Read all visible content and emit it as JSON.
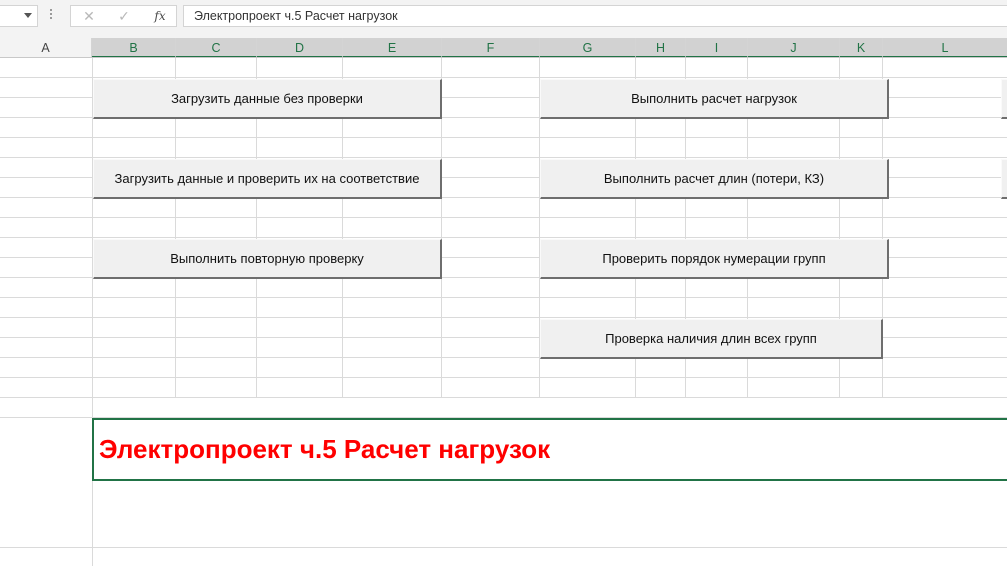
{
  "formula_bar": {
    "cancel_glyph": "✕",
    "enter_glyph": "✓",
    "fx_label": "fx",
    "formula_value": "Электропроект ч.5 Расчет нагрузок"
  },
  "columns": [
    "A",
    "B",
    "C",
    "D",
    "E",
    "F",
    "G",
    "H",
    "I",
    "J",
    "K",
    "L"
  ],
  "selected_columns": [
    "B",
    "C",
    "D",
    "E",
    "F",
    "G",
    "H",
    "I",
    "J",
    "K",
    "L"
  ],
  "buttons_left": [
    "Загрузить данные без проверки",
    "Загрузить данные и проверить их на соответствие",
    "Выполнить повторную проверку"
  ],
  "buttons_right": [
    "Выполнить расчет нагрузок",
    "Выполнить расчет длин (потери, КЗ)",
    "Проверить порядок нумерации групп",
    "Проверка наличия длин всех групп"
  ],
  "title_cell": {
    "text": "Электропроект ч.5 Расчет нагрузок",
    "color": "#ff0000"
  },
  "colors": {
    "accent": "#217346",
    "header_bg": "#f3f3f3",
    "selected_header_bg": "#d2d2d2"
  }
}
